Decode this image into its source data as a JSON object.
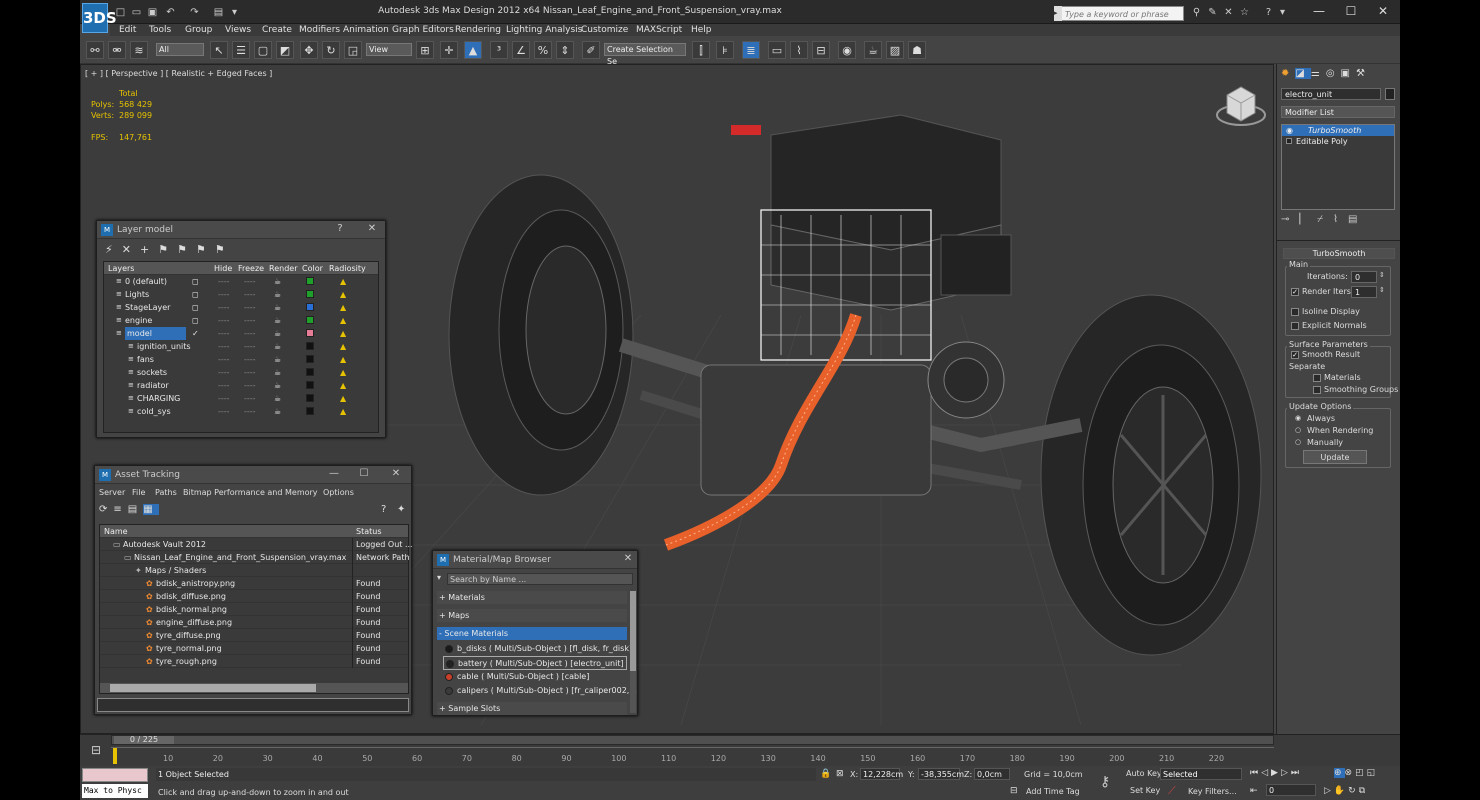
{
  "app": {
    "title": "Autodesk 3ds Max Design 2012 x64     Nissan_Leaf_Engine_and_Front_Suspension_vray.max",
    "logo": "3DS"
  },
  "search": {
    "placeholder": "Type a keyword or phrase"
  },
  "menu": [
    "Edit",
    "Tools",
    "Group",
    "Views",
    "Create",
    "Modifiers",
    "Animation",
    "Graph Editors",
    "Rendering",
    "Lighting Analysis",
    "Customize",
    "MAXScript",
    "Help"
  ],
  "toolbar": {
    "filter": "All",
    "refcoord": "View",
    "named_selection": "Create Selection Se"
  },
  "viewport": {
    "label": "[ + ] [ Perspective ] [ Realistic + Edged Faces ]",
    "stats": {
      "total_label": "Total",
      "polys_label": "Polys:",
      "polys": "568 429",
      "verts_label": "Verts:",
      "verts": "289 099",
      "fps_label": "FPS:",
      "fps": "147,761"
    }
  },
  "layer_dialog": {
    "title": "Layer model",
    "help": "?",
    "columns": [
      "Layers",
      "Hide",
      "Freeze",
      "Render",
      "Color",
      "Radiosity"
    ],
    "rows": [
      {
        "name": "0 (default)",
        "color": "#1fa02a",
        "indent": 0,
        "selected": false
      },
      {
        "name": "Lights",
        "color": "#1fa02a",
        "indent": 0,
        "selected": false
      },
      {
        "name": "StageLayer",
        "color": "#2a6fd6",
        "indent": 0,
        "selected": false
      },
      {
        "name": "engine",
        "color": "#1fa02a",
        "indent": 0,
        "selected": false
      },
      {
        "name": "model",
        "color": "#e57d96",
        "indent": 0,
        "selected": true
      },
      {
        "name": "ignition_units",
        "color": "#111111",
        "indent": 1,
        "selected": false
      },
      {
        "name": "fans",
        "color": "#111111",
        "indent": 1,
        "selected": false
      },
      {
        "name": "sockets",
        "color": "#111111",
        "indent": 1,
        "selected": false
      },
      {
        "name": "radiator",
        "color": "#111111",
        "indent": 1,
        "selected": false
      },
      {
        "name": "CHARGING",
        "color": "#111111",
        "indent": 1,
        "selected": false
      },
      {
        "name": "cold_sys",
        "color": "#111111",
        "indent": 1,
        "selected": false
      }
    ]
  },
  "asset_dialog": {
    "title": "Asset Tracking",
    "menu": [
      "Server",
      "File",
      "Paths",
      "Bitmap Performance and Memory",
      "Options"
    ],
    "columns": [
      "Name",
      "Status"
    ],
    "rows": [
      {
        "name": "Autodesk Vault 2012",
        "status": "Logged Out ...",
        "indent": 1
      },
      {
        "name": "Nissan_Leaf_Engine_and_Front_Suspension_vray.max",
        "status": "Network Path",
        "indent": 2
      },
      {
        "name": "Maps / Shaders",
        "status": "",
        "indent": 3
      },
      {
        "name": "bdisk_anistropy.png",
        "status": "Found",
        "indent": 4
      },
      {
        "name": "bdisk_diffuse.png",
        "status": "Found",
        "indent": 4
      },
      {
        "name": "bdisk_normal.png",
        "status": "Found",
        "indent": 4
      },
      {
        "name": "engine_diffuse.png",
        "status": "Found",
        "indent": 4
      },
      {
        "name": "tyre_diffuse.png",
        "status": "Found",
        "indent": 4
      },
      {
        "name": "tyre_normal.png",
        "status": "Found",
        "indent": 4
      },
      {
        "name": "tyre_rough.png",
        "status": "Found",
        "indent": 4
      }
    ]
  },
  "material_dialog": {
    "title": "Material/Map Browser",
    "search_placeholder": "Search by Name ...",
    "sections": {
      "materials": "+ Materials",
      "maps": "+ Maps",
      "scene": "- Scene Materials",
      "samples": "+ Sample Slots"
    },
    "items": [
      {
        "label": "b_disks  ( Multi/Sub-Object ) [fl_disk, fr_disk]",
        "swatch": "#1a1a1a"
      },
      {
        "label": "battery  ( Multi/Sub-Object ) [electro_unit]",
        "swatch": "#222222"
      },
      {
        "label": "cable  ( Multi/Sub-Object ) [cable]",
        "swatch": "#c8402a"
      },
      {
        "label": "calipers  ( Multi/Sub-Object ) [fr_caliper002,...",
        "swatch": "#3a3a3a"
      }
    ]
  },
  "command_panel": {
    "object_name": "electro_unit",
    "modifier_list": "Modifier List",
    "stack": [
      "TurboSmooth",
      "Editable Poly"
    ],
    "turbosmooth": {
      "title": "TurboSmooth",
      "main": "Main",
      "iterations_label": "Iterations:",
      "iterations": "0",
      "render_iters_label": "Render Iters:",
      "render_iters": "1",
      "isoline": "Isoline Display",
      "explicit": "Explicit Normals",
      "surface": "Surface Parameters",
      "smooth_result": "Smooth Result",
      "separate": "Separate",
      "materials": "Materials",
      "smoothing_groups": "Smoothing Groups",
      "update_options": "Update Options",
      "always": "Always",
      "when_rendering": "When Rendering",
      "manually": "Manually",
      "update": "Update"
    }
  },
  "timeline": {
    "frame": "0 / 225",
    "ticks": [
      "10",
      "20",
      "30",
      "40",
      "50",
      "60",
      "70",
      "80",
      "90",
      "100",
      "110",
      "120",
      "130",
      "140",
      "150",
      "160",
      "170",
      "180",
      "190",
      "200",
      "210",
      "220"
    ]
  },
  "status": {
    "maxscript": "Max to Physc",
    "selected": "1 Object Selected",
    "prompt": "Click and drag up-and-down to zoom in and out",
    "x_label": "X:",
    "x": "12,228cm",
    "y_label": "Y:",
    "y": "-38,355cm",
    "z_label": "Z:",
    "z": "0,0cm",
    "grid": "Grid = 10,0cm",
    "add_time_tag": "Add Time Tag",
    "auto_key": "Auto Key",
    "set_key": "Set Key",
    "key_mode": "Selected",
    "key_filters": "Key Filters...",
    "current_frame": "0"
  }
}
